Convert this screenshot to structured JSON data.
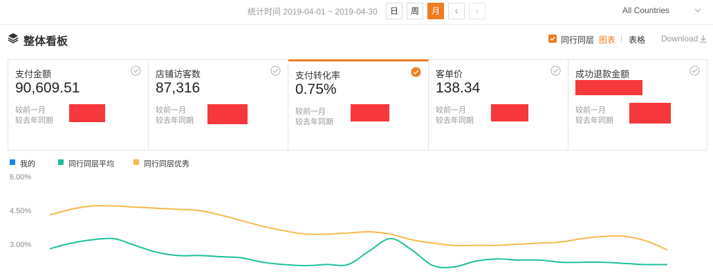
{
  "topbar": {
    "period_text": "统计时间 2019-04-01 ~ 2019-04-30",
    "period_buttons": [
      "日",
      "周",
      "月"
    ],
    "active_period": "月",
    "prev_label": "‹",
    "next_label": "›",
    "country": "All Countries"
  },
  "section": {
    "title": "整体看板",
    "peer_checkbox_label": "同行同层",
    "peer_checked": true,
    "view_chart": "图表",
    "view_separator": "|",
    "view_table": "表格",
    "active_view": "图表",
    "download": "Download"
  },
  "metrics": [
    {
      "label": "支付金额",
      "value": "90,609.51",
      "cmp_month": "较前一月",
      "cmp_year": "较去年同期",
      "selected": false
    },
    {
      "label": "店铺访客数",
      "value": "87,316",
      "cmp_month": "较前一月",
      "cmp_year": "较去年同期",
      "selected": false
    },
    {
      "label": "支付转化率",
      "value": "0.75%",
      "cmp_month": "较前一月",
      "cmp_year": "较去年同期",
      "selected": true
    },
    {
      "label": "客单价",
      "value": "138.34",
      "cmp_month": "较前一月",
      "cmp_year": "较去年同期",
      "selected": false
    },
    {
      "label": "成功退款金额",
      "value": "",
      "cmp_month": "较前一月",
      "cmp_year": "较去年同期",
      "selected": false
    }
  ],
  "colors": {
    "accent": "#f07c22",
    "mine": "#1e88e5",
    "peer_avg": "#1dbf9a",
    "peer_excellent": "#f5b94a",
    "redaction": "#f6373b"
  },
  "chart_data": {
    "type": "line",
    "y_ticks": [
      "6.00%",
      "4.50%",
      "3.00%"
    ],
    "ylim": [
      0,
      6
    ],
    "x_count": 30,
    "legend_position": "top-left",
    "series": [
      {
        "name": "我的",
        "color": "#1e88e5",
        "values": []
      },
      {
        "name": "同行同层平均",
        "color": "#1dbf9a",
        "values": [
          2.8,
          3.05,
          3.2,
          3.25,
          2.95,
          2.65,
          2.5,
          2.5,
          2.45,
          2.4,
          2.2,
          2.1,
          2.05,
          2.1,
          2.1,
          2.7,
          3.25,
          2.75,
          2.05,
          2.0,
          2.25,
          2.35,
          2.3,
          2.3,
          2.2,
          2.2,
          2.2,
          2.15,
          2.1,
          2.1
        ]
      },
      {
        "name": "同行同层优秀",
        "color": "#f5b94a",
        "values": [
          4.3,
          4.55,
          4.7,
          4.7,
          4.65,
          4.6,
          4.55,
          4.5,
          4.3,
          4.05,
          3.8,
          3.6,
          3.45,
          3.45,
          3.5,
          3.55,
          3.45,
          3.2,
          3.05,
          2.95,
          2.95,
          2.95,
          3.0,
          3.05,
          3.1,
          3.25,
          3.35,
          3.35,
          3.15,
          2.75
        ]
      }
    ]
  }
}
